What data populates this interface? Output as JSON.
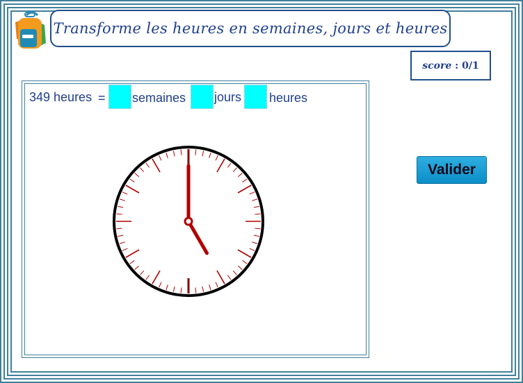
{
  "header": {
    "title": "Transforme les heures en semaines, jours et heures",
    "icon": "backpack-icon"
  },
  "score": {
    "label": "score",
    "separator": " : ",
    "value": "0/1"
  },
  "question": {
    "hours_value": "349 heures",
    "equals": "=",
    "weeks_label": "semaines",
    "days_label": "jours",
    "hours_label": "heures",
    "weeks_answer": "",
    "days_answer": "",
    "hours_answer": ""
  },
  "clock": {
    "hour": 5,
    "minute": 0,
    "face_color": "#ffffff",
    "rim_color": "#000000",
    "tick_color": "#b00000",
    "hand_color": "#b00000"
  },
  "actions": {
    "validate_label": "Valider"
  },
  "colors": {
    "frame": "#3f7f9c",
    "title_text": "#1f3f8c",
    "input_fill": "#00ffff",
    "button": "#1a9fd6"
  }
}
